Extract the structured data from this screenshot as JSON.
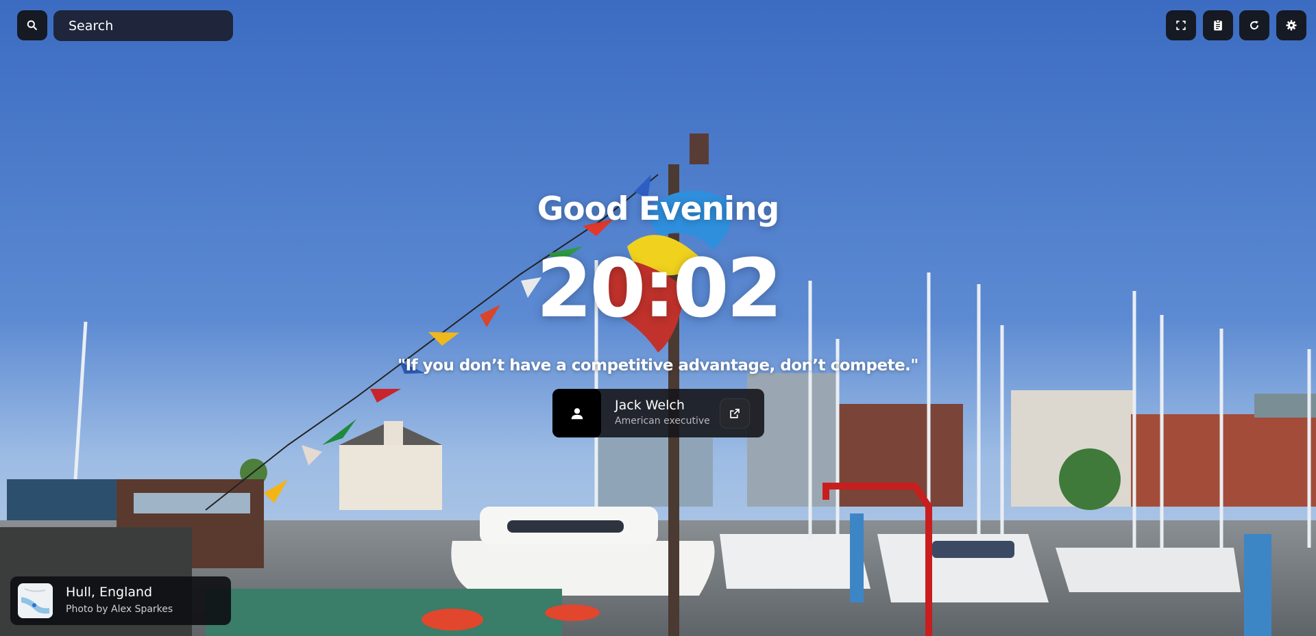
{
  "search": {
    "placeholder": "Search",
    "icon": "search-icon"
  },
  "toolbar": {
    "buttons": [
      {
        "name": "fullscreen-button",
        "icon": "fullscreen-icon"
      },
      {
        "name": "notes-button",
        "icon": "clipboard-icon"
      },
      {
        "name": "refresh-button",
        "icon": "refresh-icon"
      },
      {
        "name": "settings-button",
        "icon": "gear-icon"
      }
    ]
  },
  "greeting": "Good Evening",
  "clock": "20:02",
  "quote": {
    "text": "\"If you don’t have a competitive advantage, don’t compete.\"",
    "author": "Jack Welch",
    "author_description": "American executive"
  },
  "location": {
    "name": "Hull, England",
    "credit": "Photo by Alex Sparkes"
  },
  "colors": {
    "sky": "#4a7bca",
    "card_background": "#16161a",
    "text": "#ffffff"
  }
}
